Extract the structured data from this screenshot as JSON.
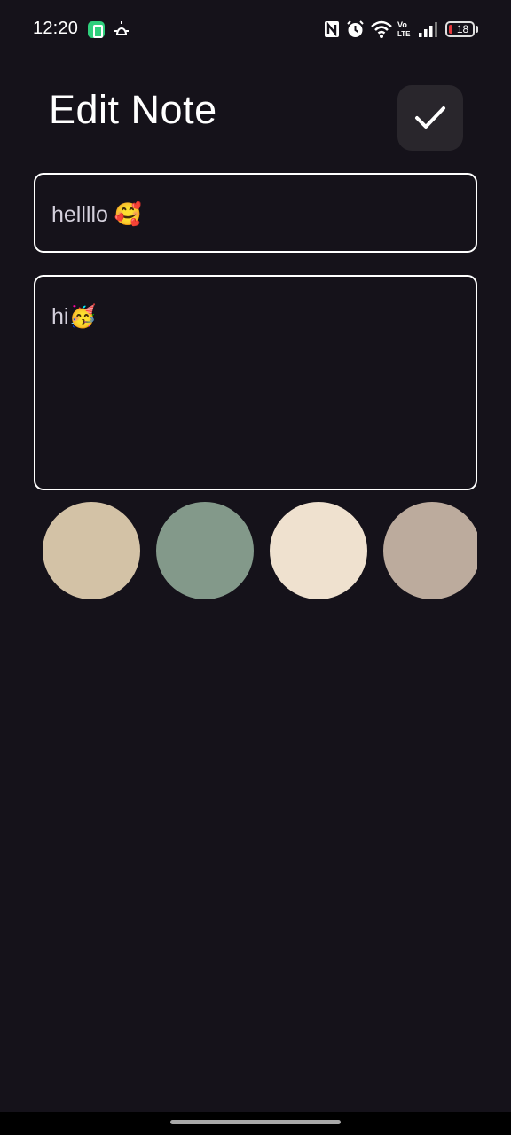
{
  "status_bar": {
    "time": "12:20",
    "battery_level": "18",
    "icons": [
      "app-badge-icon",
      "alarm-bell-icon",
      "nfc-icon",
      "alarm-clock-icon",
      "wifi-icon",
      "volte-icon",
      "signal-icon",
      "battery-icon"
    ]
  },
  "header": {
    "title": "Edit Note",
    "save_icon": "check-icon"
  },
  "note": {
    "title_value": "hellllo 🥰",
    "content_value": "hi🥳"
  },
  "colors": [
    "#d3c2a6",
    "#83998a",
    "#efe1cf",
    "#bcab9d"
  ]
}
